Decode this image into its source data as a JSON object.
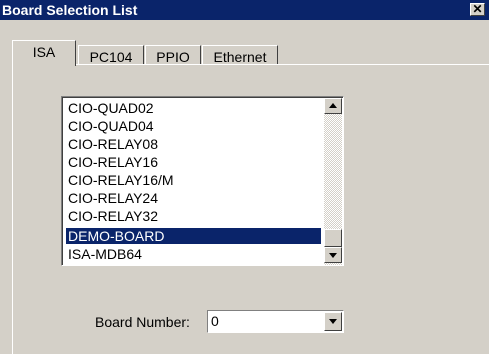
{
  "window": {
    "title": "Board Selection List",
    "close_glyph": "✕"
  },
  "tabs": [
    {
      "label": "ISA",
      "active": true
    },
    {
      "label": "PC104",
      "active": false
    },
    {
      "label": "PPIO",
      "active": false
    },
    {
      "label": "Ethernet",
      "active": false
    }
  ],
  "board_list": {
    "items": [
      "CIO-QUAD02",
      "CIO-QUAD04",
      "CIO-RELAY08",
      "CIO-RELAY16",
      "CIO-RELAY16/M",
      "CIO-RELAY24",
      "CIO-RELAY32",
      "DEMO-BOARD",
      "ISA-MDB64"
    ],
    "selected": "DEMO-BOARD"
  },
  "board_number": {
    "label": "Board Number:",
    "value": "0"
  },
  "colors": {
    "titlebar": "#0a246a",
    "selection": "#0a246a",
    "face": "#d4d0c8"
  },
  "icons": {
    "close": "close-icon",
    "scroll_up": "arrow-up-icon",
    "scroll_down": "arrow-down-icon",
    "dropdown": "chevron-down-icon"
  }
}
